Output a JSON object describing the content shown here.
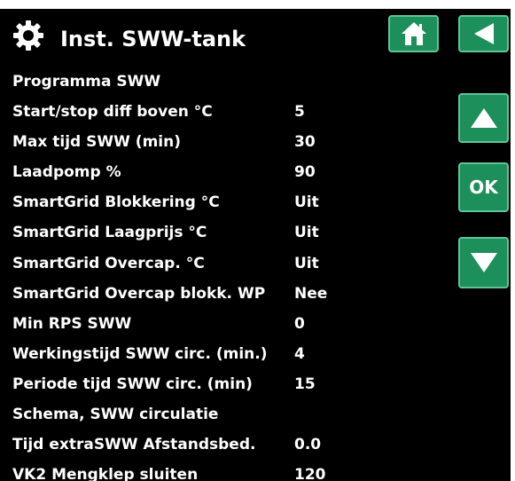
{
  "header": {
    "title": "Inst. SWW-tank",
    "settings_icon": "gear-icon",
    "home_icon": "home-icon",
    "back_icon": "back-arrow-icon"
  },
  "nav": {
    "ok_label": "OK",
    "up_icon": "arrow-up-icon",
    "down_icon": "arrow-down-icon"
  },
  "settings": [
    {
      "label": "Programma SWW",
      "value": ""
    },
    {
      "label": "Start/stop diff boven °C",
      "value": "5"
    },
    {
      "label": "Max tijd SWW (min)",
      "value": "30"
    },
    {
      "label": "Laadpomp %",
      "value": "90"
    },
    {
      "label": "SmartGrid Blokkering °C",
      "value": "Uit"
    },
    {
      "label": "SmartGrid Laagprijs °C",
      "value": "Uit"
    },
    {
      "label": "SmartGrid Overcap. °C",
      "value": "Uit"
    },
    {
      "label": "SmartGrid Overcap blokk. WP",
      "value": "Nee"
    },
    {
      "label": "Min RPS SWW",
      "value": "0"
    },
    {
      "label": "Werkingstijd SWW circ. (min.)",
      "value": "4"
    },
    {
      "label": "Periode tijd SWW circ. (min)",
      "value": "15"
    },
    {
      "label": "Schema, SWW circulatie",
      "value": ""
    },
    {
      "label": "Tijd extraSWW Afstandsbed.",
      "value": "0.0"
    },
    {
      "label": "VK2 Mengklep sluiten",
      "value": "120"
    }
  ],
  "colors": {
    "background": "#000000",
    "text": "#ffffff",
    "button_fill": "#1c8f5a",
    "button_border": "#5fc598"
  }
}
